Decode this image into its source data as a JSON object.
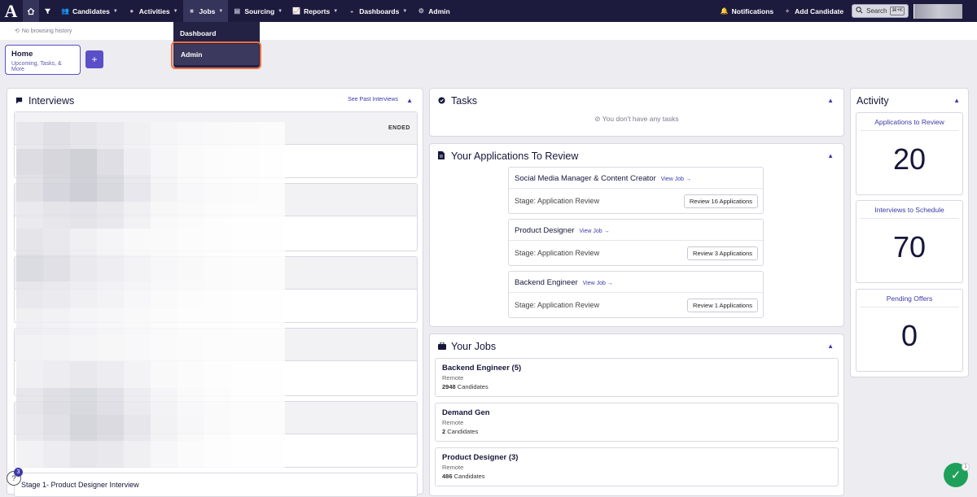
{
  "nav": {
    "logo": "A",
    "items": [
      {
        "label": "Candidates",
        "icon": "people-icon"
      },
      {
        "label": "Activities",
        "icon": "activity-icon"
      },
      {
        "label": "Jobs",
        "icon": "briefcase-icon"
      },
      {
        "label": "Sourcing",
        "icon": "sourcing-icon"
      },
      {
        "label": "Reports",
        "icon": "chart-icon"
      },
      {
        "label": "Dashboards",
        "icon": "dashboard-icon"
      },
      {
        "label": "Admin",
        "icon": "gear-icon"
      }
    ],
    "notifications": "Notifications",
    "add_candidate": "Add Candidate",
    "search_label": "Search",
    "search_shortcut": "⌘+K"
  },
  "jobs_menu": {
    "items": [
      "Dashboard",
      "Admin"
    ]
  },
  "history": {
    "text": "No browsing history"
  },
  "home_tab": {
    "title": "Home",
    "subtitle": "Upcoming, Tasks, & More",
    "add_label": "+"
  },
  "interviews": {
    "title": "Interviews",
    "see_past": "See Past Interviews",
    "ended_label": "ENDED",
    "last_item": "Stage 1- Product Designer Interview"
  },
  "tasks": {
    "title": "Tasks",
    "empty": "You don't have any tasks"
  },
  "applications": {
    "title": "Your Applications To Review",
    "view_job": "View Job →",
    "items": [
      {
        "job": "Social Media Manager & Content Creator",
        "stage": "Stage: Application Review",
        "button": "Review 16 Applications"
      },
      {
        "job": "Product Designer",
        "stage": "Stage: Application Review",
        "button": "Review 3 Applications"
      },
      {
        "job": "Backend Engineer",
        "stage": "Stage: Application Review",
        "button": "Review 1 Applications"
      }
    ]
  },
  "jobs": {
    "title": "Your Jobs",
    "items": [
      {
        "name": "Backend Engineer (5)",
        "location": "Remote",
        "count": "2948",
        "count_label": "Candidates"
      },
      {
        "name": "Demand Gen",
        "location": "Remote",
        "count": "2",
        "count_label": "Candidates"
      },
      {
        "name": "Product Designer (3)",
        "location": "Remote",
        "count": "486",
        "count_label": "Candidates"
      }
    ]
  },
  "activity": {
    "title": "Activity",
    "cards": [
      {
        "label": "Applications to Review",
        "value": "20"
      },
      {
        "label": "Interviews to Schedule",
        "value": "70"
      },
      {
        "label": "Pending Offers",
        "value": "0"
      }
    ]
  },
  "help": {
    "icon": "?",
    "badge": "3"
  },
  "checklist": {
    "badge": "1"
  }
}
